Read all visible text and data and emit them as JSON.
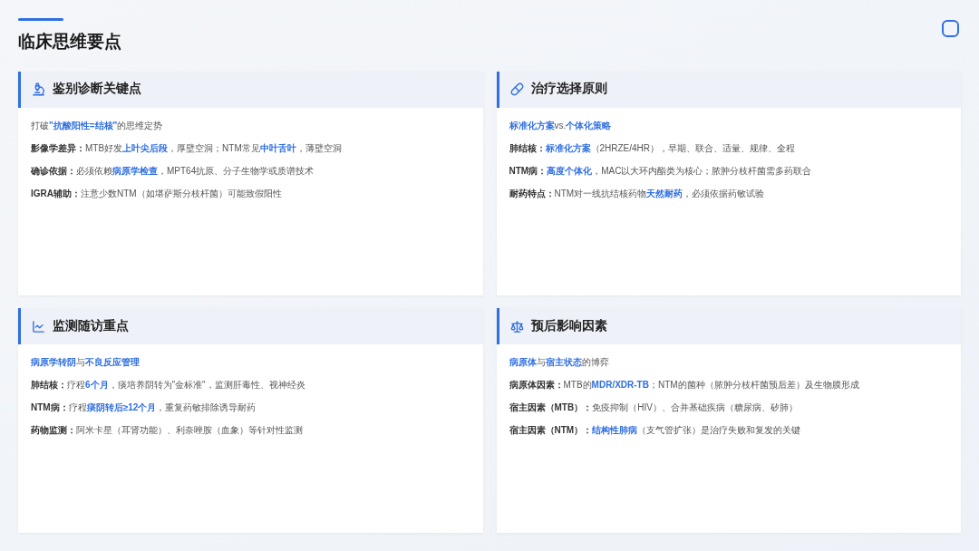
{
  "title": "临床思维要点",
  "cards": [
    {
      "title": "鉴别诊断关键点",
      "summary": "打破**\"抗酸阳性=结核\"**的思维定势",
      "items": [
        {
          "label": "影像学差异：",
          "text": "MTB好发**上叶尖后段**，厚壁空洞；NTM常见**中叶舌叶**，薄壁空洞"
        },
        {
          "label": "确诊依据：",
          "text": "必须依赖**病原学检查**，MPT64抗原、分子生物学或质谱技术"
        },
        {
          "label": "IGRA辅助：",
          "text": "注意少数NTM（如堪萨斯分枝杆菌）可能致假阳性"
        }
      ]
    },
    {
      "title": "治疗选择原则",
      "summary": "**标准化方案**vs.**个体化策略**",
      "items": [
        {
          "label": "肺结核：",
          "text": "**标准化方案**（2HRZE/4HR），早期、联合、适量、规律、全程"
        },
        {
          "label": "NTM病：",
          "text": "**高度个体化**，MAC以大环内酯类为核心；脓肿分枝杆菌需多药联合"
        },
        {
          "label": "耐药特点：",
          "text": "NTM对一线抗结核药物**天然耐药**，必须依据药敏试验"
        }
      ]
    },
    {
      "title": "监测随访重点",
      "summary": "**病原学转阴**与**不良反应管理**",
      "items": [
        {
          "label": "肺结核：",
          "text": "疗程**6个月**，痰培养阴转为\"金标准\"，监测肝毒性、视神经炎"
        },
        {
          "label": "NTM病：",
          "text": "疗程**痰阴转后≥12个月**，重复药敏排除诱导耐药"
        },
        {
          "label": "药物监测：",
          "text": "阿米卡星（耳肾功能）、利奈唑胺（血象）等针对性监测"
        }
      ]
    },
    {
      "title": "预后影响因素",
      "summary": "**病原体**与**宿主状态**的博弈",
      "items": [
        {
          "label": "病原体因素：",
          "text": "MTB的**MDR/XDR-TB**；NTM的菌种（脓肿分枝杆菌预后差）及生物膜形成"
        },
        {
          "label": "宿主因素（MTB）：",
          "text": "免疫抑制（HIV）、合并基础疾病（糖尿病、矽肺）"
        },
        {
          "label": "宿主因素（NTM）：",
          "text": "**结构性肺病**（支气管扩张）是治疗失败和复发的关键"
        }
      ]
    }
  ]
}
